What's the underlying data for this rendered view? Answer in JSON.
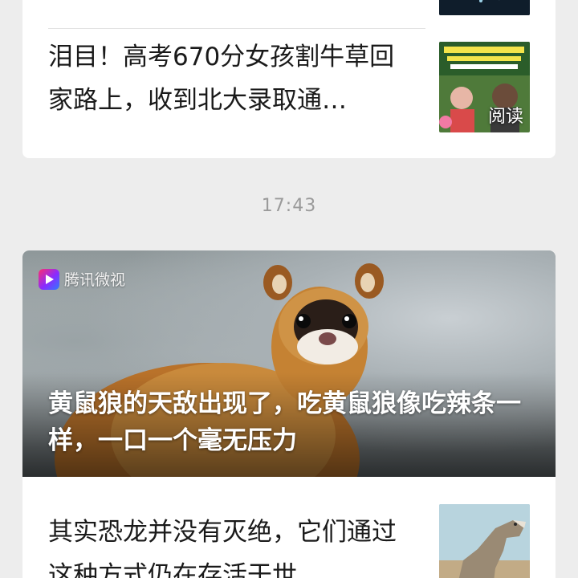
{
  "feed": {
    "articles_top": [
      {
        "title": "",
        "image_icon": "night-performer-thumbnail"
      },
      {
        "title": "泪目！高考670分女孩割牛草回家路上，收到北大录取通…",
        "image_icon": "news-collage-thumbnail",
        "thumb_badge": "阅读"
      }
    ],
    "timestamp": "17:43",
    "featured": {
      "source_label": "腾讯微视",
      "source_icon": "weishi-play-icon",
      "title": "黄鼠狼的天敌出现了，吃黄鼠狼像吃辣条一样，一口一个毫无压力",
      "image_icon": "marten-photo"
    },
    "articles_bottom": [
      {
        "title": "其实恐龙并没有灭绝，它们通过这种方式仍在存活于世",
        "image_icon": "dinosaur-thumbnail"
      }
    ]
  },
  "colors": {
    "background": "#ededed",
    "card": "#ffffff",
    "timestamp": "#9a9a9a",
    "title_text": "#1a1a1a"
  }
}
